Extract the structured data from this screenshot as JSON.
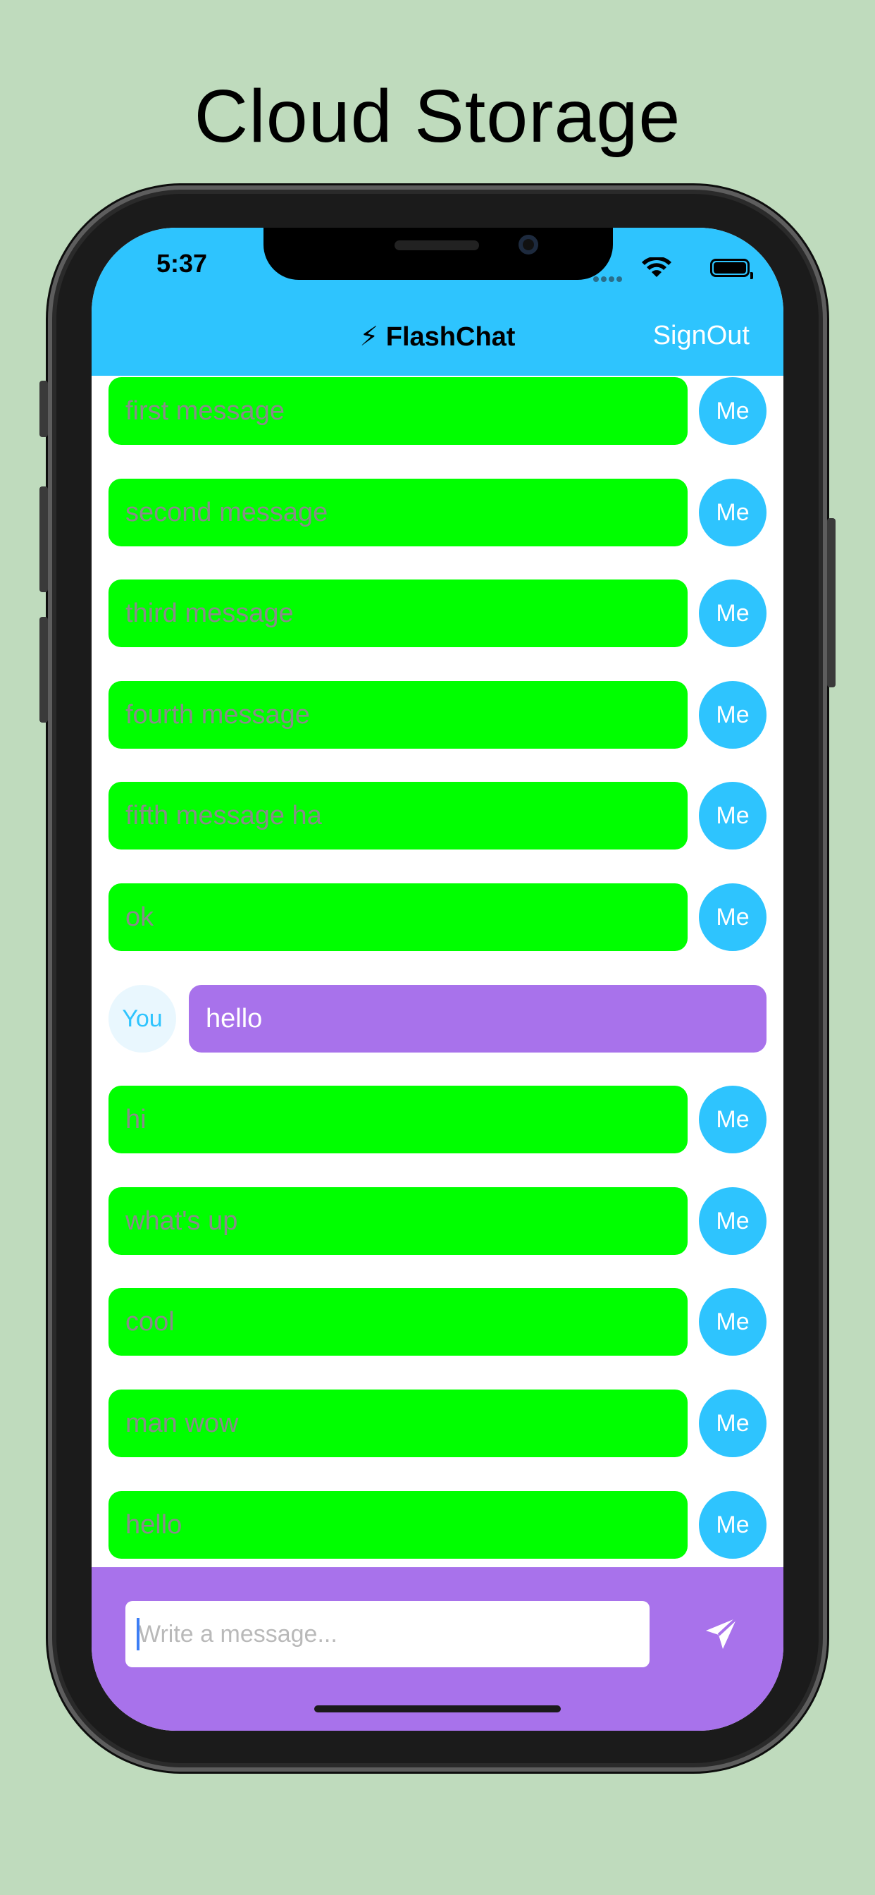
{
  "page": {
    "heading": "Cloud Storage"
  },
  "status_bar": {
    "time": "5:37"
  },
  "navbar": {
    "title": "⚡ FlashChat",
    "signout_label": "SignOut"
  },
  "messages": [
    {
      "sender": "me",
      "text": "first message",
      "avatar": "Me"
    },
    {
      "sender": "me",
      "text": "second message",
      "avatar": "Me"
    },
    {
      "sender": "me",
      "text": "third message",
      "avatar": "Me"
    },
    {
      "sender": "me",
      "text": "fourth message",
      "avatar": "Me"
    },
    {
      "sender": "me",
      "text": "fifth message ha",
      "avatar": "Me"
    },
    {
      "sender": "me",
      "text": "ok",
      "avatar": "Me"
    },
    {
      "sender": "you",
      "text": "hello",
      "avatar": "You"
    },
    {
      "sender": "me",
      "text": "hi",
      "avatar": "Me"
    },
    {
      "sender": "me",
      "text": "what's up",
      "avatar": "Me"
    },
    {
      "sender": "me",
      "text": "cool",
      "avatar": "Me"
    },
    {
      "sender": "me",
      "text": "man wow",
      "avatar": "Me"
    },
    {
      "sender": "me",
      "text": "hello",
      "avatar": "Me"
    }
  ],
  "composer": {
    "placeholder": "Write a message...",
    "value": "",
    "send_icon": "paper-plane-icon"
  },
  "colors": {
    "background": "#bfdbbd",
    "navbar": "#2ec4fe",
    "my_bubble": "#00ff00",
    "their_bubble": "#a872eb",
    "composer": "#a872eb"
  }
}
